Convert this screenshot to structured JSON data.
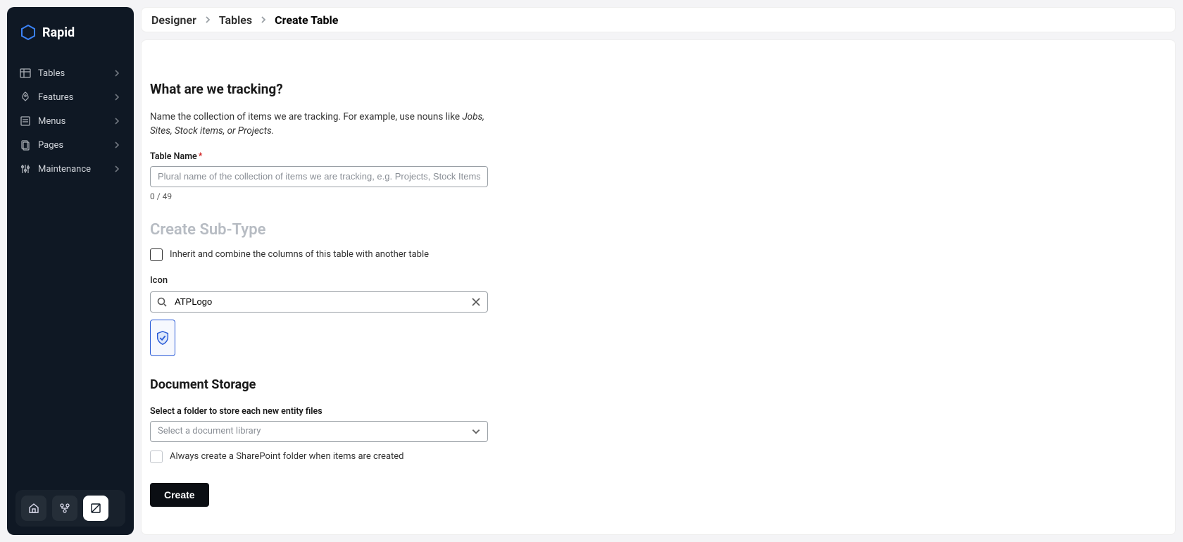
{
  "brand": {
    "name": "Rapid"
  },
  "sidebar": {
    "items": [
      {
        "label": "Tables"
      },
      {
        "label": "Features"
      },
      {
        "label": "Menus"
      },
      {
        "label": "Pages"
      },
      {
        "label": "Maintenance"
      }
    ]
  },
  "breadcrumb": {
    "root": "Designer",
    "mid": "Tables",
    "current": "Create Table"
  },
  "form": {
    "tracking_heading": "What are we tracking?",
    "tracking_helper_prefix": "Name the collection of items we are tracking. For example, use nouns like ",
    "tracking_helper_examples": "Jobs, Sites, Stock items, or Projects.",
    "table_name_label": "Table Name",
    "table_name_placeholder": "Plural name of the collection of items we are tracking, e.g. Projects, Stock Items, etc.",
    "table_name_value": "",
    "table_name_counter": "0 / 49",
    "subtype_heading": "Create Sub-Type",
    "inherit_label": "Inherit and combine the columns of this table with another table",
    "icon_label": "Icon",
    "icon_search_value": "ATPLogo",
    "doc_storage_heading": "Document Storage",
    "folder_label": "Select a folder to store each new entity files",
    "doclib_placeholder": "Select a document library",
    "sharepoint_label": "Always create a SharePoint folder when items are created",
    "create_button": "Create"
  }
}
